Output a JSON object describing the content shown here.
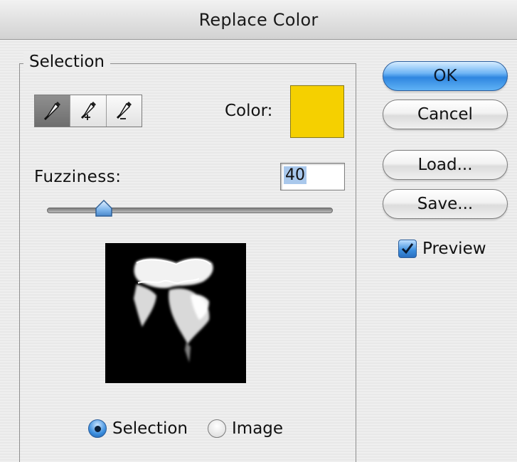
{
  "window": {
    "title": "Replace Color"
  },
  "selection_group": {
    "legend": "Selection",
    "tools": [
      {
        "name": "eyedropper-icon",
        "active": true
      },
      {
        "name": "eyedropper-add-icon",
        "active": false
      },
      {
        "name": "eyedropper-subtract-icon",
        "active": false
      }
    ],
    "color_label": "Color:",
    "color_value": "#f5d000",
    "fuzziness_label": "Fuzziness:",
    "fuzziness_value": "40",
    "fuzziness_fraction": 0.2,
    "view_options": [
      {
        "label": "Selection",
        "selected": true
      },
      {
        "label": "Image",
        "selected": false
      }
    ]
  },
  "buttons": {
    "ok": "OK",
    "cancel": "Cancel",
    "load": "Load...",
    "save": "Save..."
  },
  "preview_checkbox": {
    "label": "Preview",
    "checked": true
  }
}
